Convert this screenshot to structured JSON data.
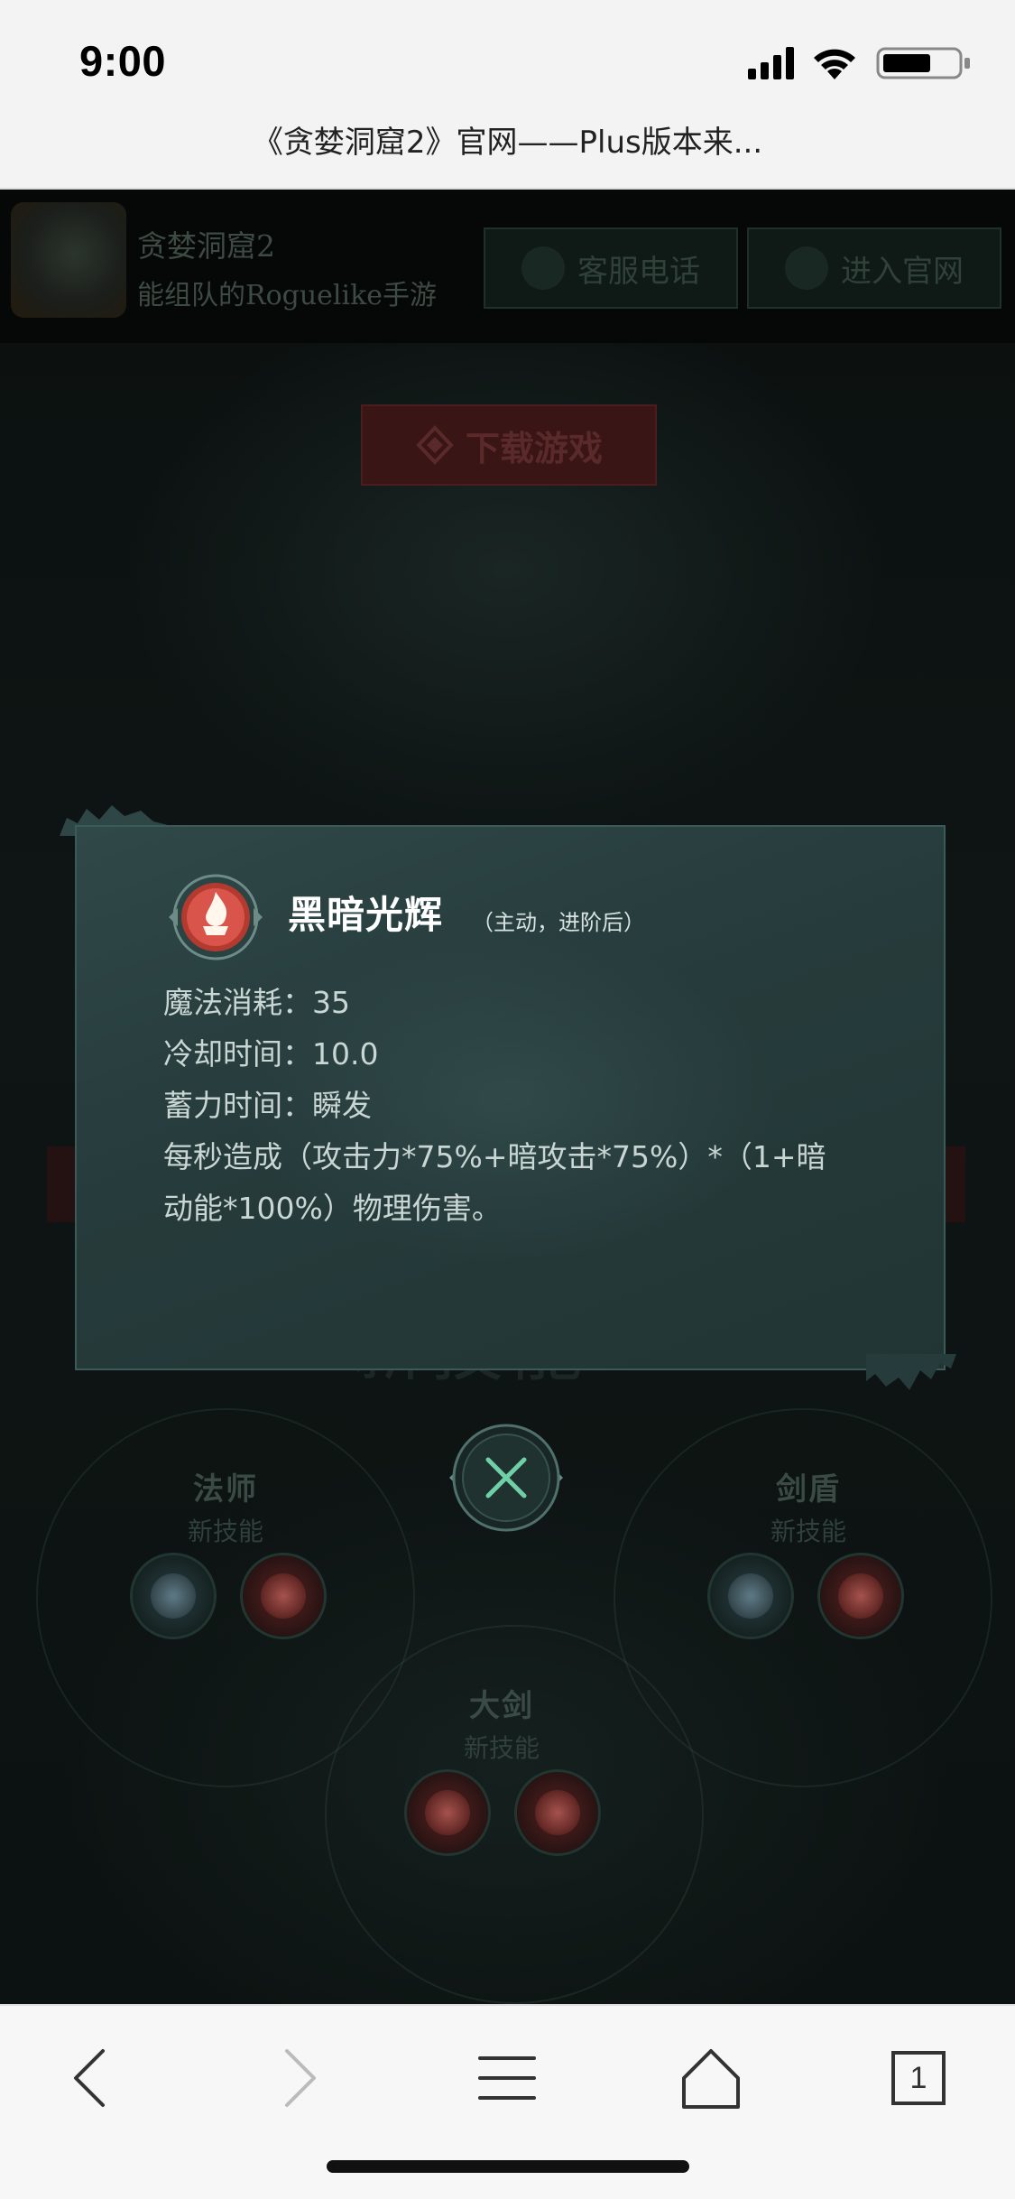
{
  "status_bar": {
    "time": "9:00"
  },
  "browser": {
    "page_title": "《贪婪洞窟2》官网——Plus版本来..."
  },
  "site_header": {
    "name": "贪婪洞窟2",
    "tagline": "能组队的Roguelike手游",
    "service_phone_label": "客服电话",
    "official_site_label": "进入官网"
  },
  "download_label": "下载游戏",
  "classes": [
    {
      "name": "法师",
      "subtitle": "新技能"
    },
    {
      "name": "剑盾",
      "subtitle": "新技能"
    },
    {
      "name": "大剑",
      "subtitle": "新技能"
    }
  ],
  "modal": {
    "skill_name": "黑暗光辉",
    "skill_tag": "（主动，进阶后）",
    "mana_cost": "魔法消耗：35",
    "cooldown": "冷却时间：10.0",
    "charge_time": "蓄力时间：瞬发",
    "description_line1": "每秒造成（攻击力*75%+暗攻击*75%）*（1+暗",
    "description_line2": "动能*100%）物理伤害。"
  },
  "toolbar": {
    "tab_count": "1"
  },
  "colors": {
    "modal_bg": "#2a4040",
    "accent_green": "#5fbf9a",
    "danger_red": "#8a2a2a"
  }
}
